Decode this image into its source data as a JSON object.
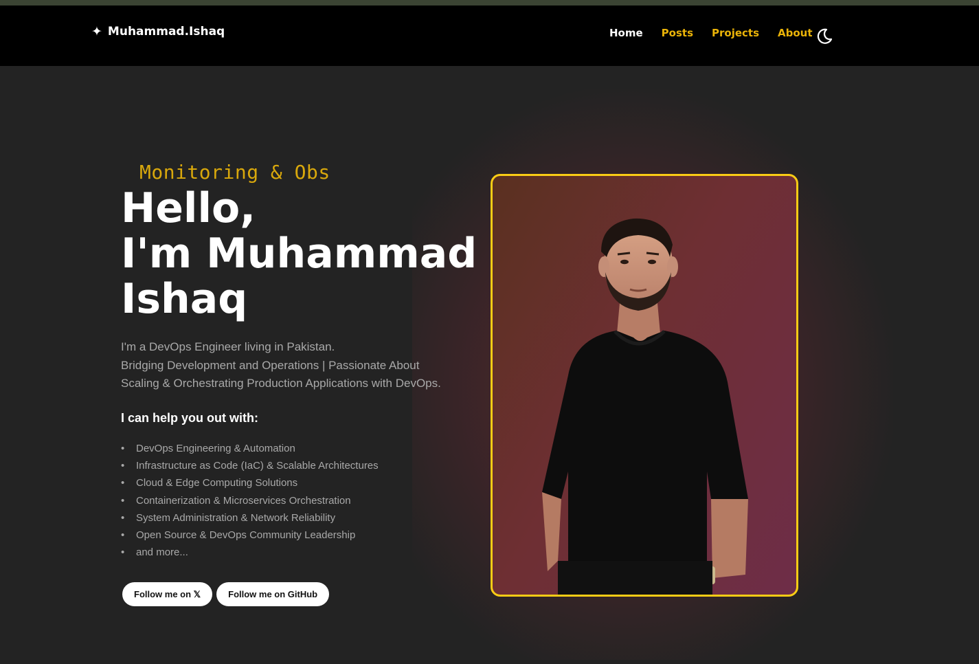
{
  "brand": {
    "icon": "sparkle-icon",
    "name": "Muhammad.Ishaq"
  },
  "nav": [
    {
      "label": "Home",
      "active": true
    },
    {
      "label": "Posts",
      "active": false
    },
    {
      "label": "Projects",
      "active": false
    },
    {
      "label": "About",
      "active": false
    }
  ],
  "theme_toggle": {
    "icon": "moon-icon"
  },
  "hero": {
    "eyebrow": "Monitoring & Obs",
    "title_line1": "Hello,",
    "title_line2": "I'm Muhammad",
    "title_line3": "Ishaq",
    "intro_line1": "I'm a DevOps Engineer living in Pakistan.",
    "intro_line2": "Bridging Development and Operations | Passionate About",
    "intro_line3": "Scaling & Orchestrating Production Applications with DevOps.",
    "help_heading": "I can help you out with:",
    "skills": [
      "DevOps Engineering & Automation",
      "Infrastructure as Code (IaC) & Scalable Architectures",
      "Cloud & Edge Computing Solutions",
      "Containerization & Microservices Orchestration",
      "System Administration & Network Reliability",
      "Open Source & DevOps Community Leadership",
      "and more..."
    ],
    "buttons": {
      "x_label": "Follow me on 𝕏",
      "github_label": "Follow me on GitHub"
    }
  },
  "colors": {
    "accent": "#facc15",
    "nav_link": "#eab308",
    "background": "#232323",
    "navbar": "#000000"
  }
}
